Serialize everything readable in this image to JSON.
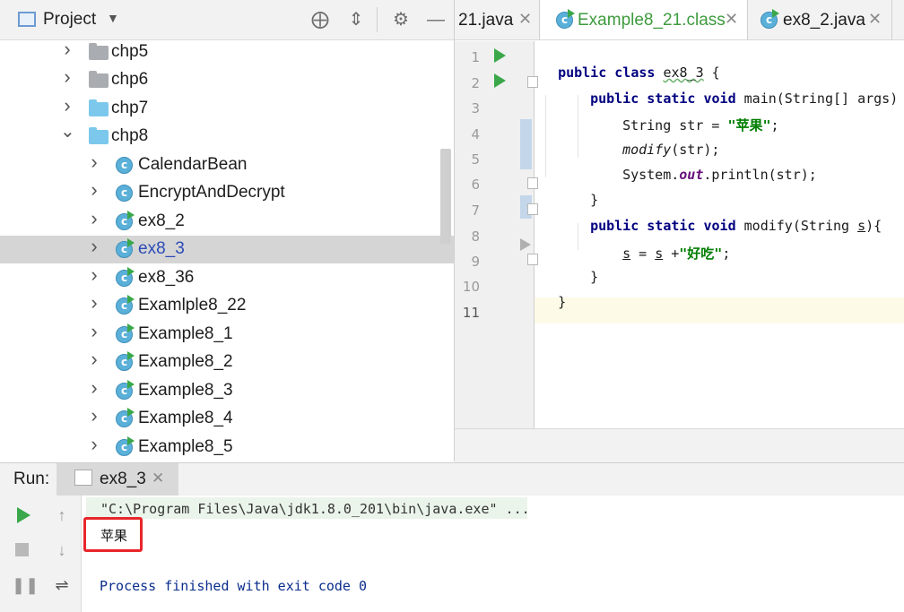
{
  "project": {
    "title": "Project",
    "icons": [
      "crosshair-icon",
      "collapse-icon",
      "gear-icon",
      "minimize-icon"
    ],
    "tree": [
      {
        "label": "chp5",
        "kind": "folder-gray",
        "expanded": false
      },
      {
        "label": "chp6",
        "kind": "folder-gray",
        "expanded": false
      },
      {
        "label": "chp7",
        "kind": "folder-blue",
        "expanded": false
      },
      {
        "label": "chp8",
        "kind": "folder-blue",
        "expanded": true
      },
      {
        "label": "CalendarBean",
        "kind": "class",
        "runnable": false
      },
      {
        "label": "EncryptAndDecrypt",
        "kind": "class",
        "runnable": false
      },
      {
        "label": "ex8_2",
        "kind": "class",
        "runnable": true
      },
      {
        "label": "ex8_3",
        "kind": "class",
        "runnable": true,
        "selected": true
      },
      {
        "label": "ex8_36",
        "kind": "class",
        "runnable": true
      },
      {
        "label": "Examlple8_22",
        "kind": "class",
        "runnable": true
      },
      {
        "label": "Example8_1",
        "kind": "class",
        "runnable": true
      },
      {
        "label": "Example8_2",
        "kind": "class",
        "runnable": true
      },
      {
        "label": "Example8_3",
        "kind": "class",
        "runnable": true
      },
      {
        "label": "Example8_4",
        "kind": "class",
        "runnable": true
      },
      {
        "label": "Example8_5",
        "kind": "class",
        "runnable": true
      }
    ]
  },
  "tabs": [
    {
      "label": "21.java",
      "active": false
    },
    {
      "label": "Example8_21.class",
      "active": true
    },
    {
      "label": "ex8_2.java",
      "active": false
    }
  ],
  "editor": {
    "line_numbers": [
      "1",
      "2",
      "3",
      "4",
      "5",
      "6",
      "7",
      "8",
      "9",
      "10",
      "11"
    ],
    "code": {
      "l1_kw": "public class ",
      "l1_name": "ex8_3",
      "l1_rest": " {",
      "l2_kw": "public static void ",
      "l2_rest": "main(String[] args) {",
      "l3_a": "String str = ",
      "l3_str": "\"苹果\"",
      "l3_b": ";",
      "l4_call": "modify",
      "l4_rest": "(str);",
      "l5_a": "System.",
      "l5_field": "out",
      "l5_b": ".println(str);",
      "l6": "}",
      "l7_kw": "public static void ",
      "l7_a": "modify(String ",
      "l7_param": "s",
      "l7_b": "){",
      "l8_a": "s",
      "l8_b": " = ",
      "l8_c": "s",
      "l8_d": " +",
      "l8_str": "\"好吃\"",
      "l8_e": ";",
      "l9": "}",
      "l10": "}"
    }
  },
  "run": {
    "label": "Run:",
    "tab_label": "ex8_3",
    "command": "\"C:\\Program Files\\Java\\jdk1.8.0_201\\bin\\java.exe\" ...",
    "output": "苹果",
    "finish": "Process finished with exit code 0"
  },
  "colors": {
    "keyword": "#000080",
    "string": "#007e00",
    "run_green": "#3aa84a",
    "highlight_box": "#e8262b",
    "console_text": "#0b2d8c"
  }
}
